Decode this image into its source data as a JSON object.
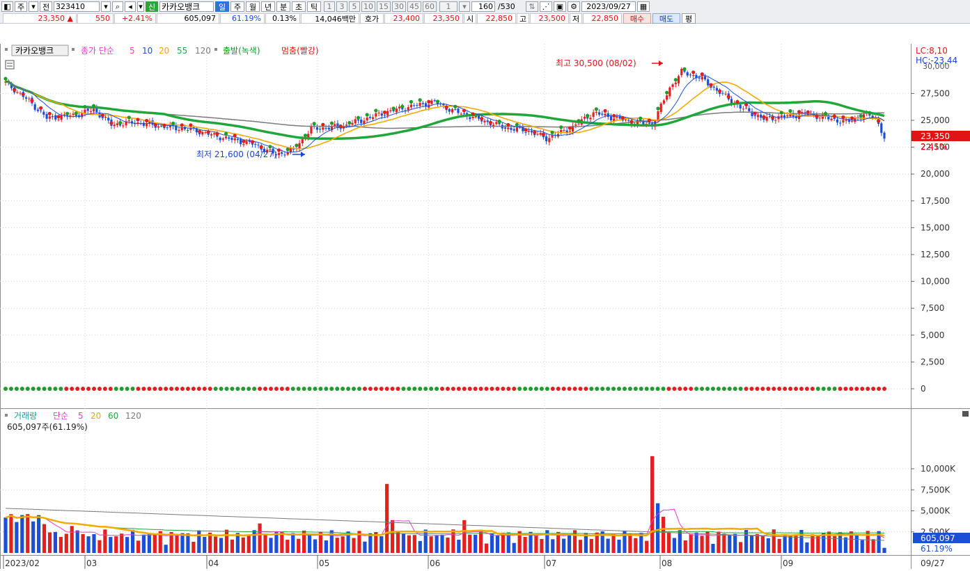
{
  "toolbar": {
    "code": "323410",
    "name": "카카오뱅크",
    "count": "160",
    "total": "/530",
    "date": "2023/09/27",
    "labels": {
      "ju": "주",
      "jeon": "전",
      "shin": "신",
      "il": "일",
      "jub": "주",
      "wol": "월",
      "nyeon": "년",
      "bun": "분",
      "cho": "초",
      "tik": "틱",
      "sel": "1"
    },
    "periods": [
      "1",
      "3",
      "5",
      "10",
      "15",
      "30",
      "45",
      "60"
    ]
  },
  "info": {
    "price": "23,350 ▲",
    "change": "550",
    "change_pct": "+2.41%",
    "volume": "605,097",
    "vol_ratio": "61.19%",
    "turnover": "0.13%",
    "amount": "14,046백만",
    "hoga_label": "호가",
    "ask": "23,400",
    "bid": "23,350",
    "open_label": "시",
    "open": "22,850",
    "high_label": "고",
    "high": "23,500",
    "low_label": "저",
    "low": "22,850",
    "buy": "매수",
    "sell": "매도",
    "eval": "평"
  },
  "price_pane": {
    "legend": {
      "name": "카카오뱅크",
      "close": "종가 단순",
      "ma5": "5",
      "ma10": "10",
      "ma20": "20",
      "ma55": "55",
      "ma120": "120",
      "start": "출발(녹색)",
      "stop": "멈춤(빨강)"
    },
    "annot_high": "최고 30,500 (08/02)",
    "annot_low": "최저 21,600 (04/27)",
    "lc": "LC:8,10",
    "hc": "HC:-23,44",
    "cur_price": "23,350",
    "cur_pct": "2.41%",
    "y_ticks": [
      "27,500",
      "25,000",
      "22,500",
      "20,000",
      "17,500",
      "15,000",
      "12,500",
      "10,000",
      "7,500",
      "5,000",
      "2,500",
      "0"
    ],
    "y_values": [
      27500,
      25000,
      22500,
      20000,
      17500,
      15000,
      12500,
      10000,
      7500,
      5000,
      2500,
      0
    ],
    "top_cut": "30,000"
  },
  "volume_pane": {
    "legend": {
      "name": "거래량",
      "simple": "단순",
      "ma5": "5",
      "ma20": "20",
      "ma60": "60",
      "ma120": "120"
    },
    "sub": "605,097주(61.19%)",
    "y_ticks": [
      "10,000K",
      "7,500K",
      "5,000K",
      "2,500K"
    ],
    "y_values": [
      10000,
      7500,
      5000,
      2500
    ],
    "cur_vol": "605,097",
    "cur_pct": "61.19%"
  },
  "x_axis": {
    "labels": [
      "2023/02",
      "03",
      "04",
      "05",
      "06",
      "07",
      "08",
      "09"
    ],
    "end": "09/27"
  },
  "colors": {
    "up": "#e32020",
    "down": "#1c4fd6",
    "ma5": "#1c4fd6",
    "ma10": "#e040c8",
    "ma20": "#f2a900",
    "ma55": "#21a63a",
    "ma120": "#7a7a7a"
  }
}
